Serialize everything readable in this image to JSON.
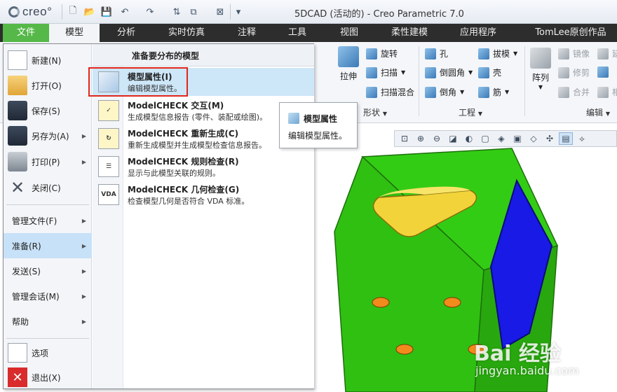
{
  "app": {
    "title": "5DCAD (活动的) - Creo Parametric 7.0",
    "logo_text": "creo",
    "logo_mark": "°"
  },
  "quick_access": [
    {
      "icon": "new-icon",
      "glyph": "🗋"
    },
    {
      "icon": "open-icon",
      "glyph": "📂"
    },
    {
      "icon": "save-icon",
      "glyph": "💾"
    },
    {
      "icon": "undo-icon",
      "glyph": "↶"
    },
    {
      "icon": "redo-icon",
      "glyph": "↷"
    },
    {
      "icon": "regenerate-icon",
      "glyph": "⇅"
    },
    {
      "icon": "windows-icon",
      "glyph": "⧉"
    },
    {
      "icon": "close-window-icon",
      "glyph": "⊠"
    },
    {
      "icon": "customize-icon",
      "glyph": "▾"
    }
  ],
  "tabs": [
    {
      "name": "tab-file",
      "label": "文件"
    },
    {
      "name": "tab-model",
      "label": "模型"
    },
    {
      "name": "tab-analysis",
      "label": "分析"
    },
    {
      "name": "tab-simulation",
      "label": "实时仿真"
    },
    {
      "name": "tab-annotate",
      "label": "注释"
    },
    {
      "name": "tab-tools",
      "label": "工具"
    },
    {
      "name": "tab-view",
      "label": "视图"
    },
    {
      "name": "tab-flexible",
      "label": "柔性建模"
    },
    {
      "name": "tab-apps",
      "label": "应用程序"
    },
    {
      "name": "tab-tomlee",
      "label": "TomLee原创作品"
    }
  ],
  "ribbon": {
    "extrude": "拉伸",
    "revolve": "旋转",
    "sweep": "扫描",
    "swept_blend": "扫描混合",
    "shapes_group": "形状",
    "hole": "孔",
    "draft": "拔模",
    "round": "倒圆角",
    "shell": "壳",
    "chamfer": "倒角",
    "rib": "筋",
    "engineering_group": "工程",
    "pattern": "阵列",
    "mirror": "镜像",
    "extend": "延",
    "trim": "修剪",
    "merge": "合并",
    "intersect": "相",
    "editing_group": "编辑"
  },
  "file_menu": {
    "items_top": [
      {
        "name": "file-new",
        "label": "新建(N)",
        "icon": "new-doc-icon",
        "arrow": false
      },
      {
        "name": "file-open",
        "label": "打开(O)",
        "icon": "open-folder-icon",
        "arrow": false
      },
      {
        "name": "file-save",
        "label": "保存(S)",
        "icon": "save-disk-icon",
        "arrow": false
      },
      {
        "name": "file-save-as",
        "label": "另存为(A)",
        "icon": "save-as-icon",
        "arrow": true
      },
      {
        "name": "file-print",
        "label": "打印(P)",
        "icon": "printer-icon",
        "arrow": true
      },
      {
        "name": "file-close",
        "label": "关闭(C)",
        "icon": "close-x-icon",
        "arrow": false
      }
    ],
    "items_mid": [
      {
        "name": "file-manage",
        "label": "管理文件(F)",
        "arrow": true
      },
      {
        "name": "file-prepare",
        "label": "准备(R)",
        "arrow": true,
        "selected": true
      },
      {
        "name": "file-send",
        "label": "发送(S)",
        "arrow": true
      },
      {
        "name": "file-manage-session",
        "label": "管理会话(M)",
        "arrow": true
      },
      {
        "name": "file-help",
        "label": "帮助",
        "arrow": true
      }
    ],
    "items_bottom": [
      {
        "name": "file-options",
        "label": "选项",
        "icon": "options-icon"
      },
      {
        "name": "file-exit",
        "label": "退出(X)",
        "icon": "exit-icon"
      }
    ],
    "submenu_header": "准备要分布的模型",
    "submenu_items": [
      {
        "name": "model-properties",
        "title": "模型属性(I)",
        "desc": "编辑模型属性。",
        "icon": "model-properties-icon",
        "glyph": "",
        "highlight": true
      },
      {
        "name": "modelcheck-interactive",
        "title": "ModelCHECK 交互(M)",
        "desc": "生成模型信息报告 (零件、装配或绘图)。",
        "icon": "modelcheck-interactive-icon",
        "glyph": "✓"
      },
      {
        "name": "modelcheck-regenerate",
        "title": "ModelCHECK 重新生成(C)",
        "desc": "重新生成模型并生成模型检查信息报告。",
        "icon": "modelcheck-regenerate-icon",
        "glyph": "↻"
      },
      {
        "name": "modelcheck-rule-check",
        "title": "ModelCHECK 规则检查(R)",
        "desc": "显示与此模型关联的规则。",
        "icon": "modelcheck-rules-icon",
        "glyph": "☰"
      },
      {
        "name": "modelcheck-geometry-check",
        "title": "ModelCHECK 几何检查(G)",
        "desc": "检查模型几何是否符合 VDA 标准。",
        "icon": "modelcheck-vda-icon",
        "glyph": "VDA"
      }
    ]
  },
  "tooltip": {
    "title": "模型属性",
    "desc": "编辑模型属性。"
  },
  "watermark": {
    "logo": "Bai 经验",
    "url": "jingyan.baidu.com"
  },
  "colors": {
    "file_tab": "#55b848",
    "tab_bar": "#2d2d2d",
    "highlight_box": "#e1261c",
    "selection": "#c7e1f8",
    "model_green": "#33cc14",
    "model_blue": "#1a1ae6",
    "model_yellow": "#f2d43a",
    "hole_orange": "#f28a1c"
  }
}
